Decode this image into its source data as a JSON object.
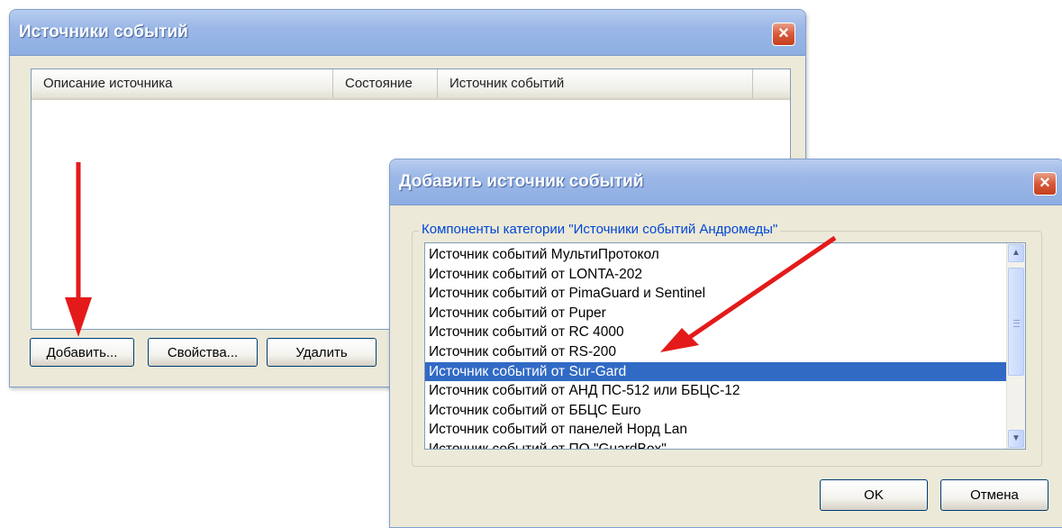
{
  "main_window": {
    "title": "Источники событий",
    "close_label": "×",
    "columns": [
      "Описание источника",
      "Состояние",
      "Источник событий"
    ],
    "buttons": {
      "add": "Добавить...",
      "properties": "Свойства...",
      "delete": "Удалить"
    }
  },
  "add_dialog": {
    "title": "Добавить источник событий",
    "close_label": "×",
    "group_label": "Компоненты категории \"Источники событий Андромеды\"",
    "items": [
      "Источник событий МультиПротокол",
      "Источник событий от LONTA-202",
      "Источник событий от PimaGuard и Sentinel",
      "Источник событий от Puper",
      "Источник событий от RC 4000",
      "Источник событий от RS-200",
      "Источник событий от Sur-Gard",
      "Источник событий от АНД ПС-512 или ББЦС-12",
      "Источник событий от ББЦС Euro",
      "Источник событий от панелей Норд Lan",
      "Источник событий от ПО \"GuardBox\""
    ],
    "selected_item": "Источник событий от Sur-Gard",
    "buttons": {
      "ok": "OK",
      "cancel": "Отмена"
    },
    "scroll_up_glyph": "▲",
    "scroll_down_glyph": "▼"
  },
  "colors": {
    "selection": "#316ac5",
    "annotation_arrow": "#e41a1a",
    "group_label": "#0046d5"
  }
}
